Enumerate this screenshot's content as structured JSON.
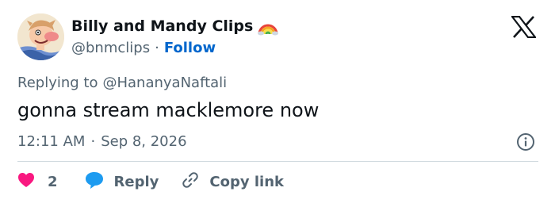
{
  "author": {
    "name": "Billy and Mandy Clips",
    "handle": "@bnmclips",
    "separator": "·",
    "follow_label": "Follow",
    "badge_icon": "rainbow-emoji"
  },
  "brand": {
    "logo_icon": "x-logo-icon"
  },
  "reply_context": {
    "prefix": "Replying to",
    "target": "@HananyaNaftali"
  },
  "tweet": {
    "text": "gonna stream macklemore now",
    "time": "12:11 AM",
    "separator": "·",
    "date": "Sep 8, 2026"
  },
  "actions": {
    "like_count": "2",
    "reply_label": "Reply",
    "copy_label": "Copy link"
  },
  "colors": {
    "text_primary": "#0f1419",
    "text_secondary": "#536471",
    "link": "#0066cc",
    "like": "#f91880",
    "reply": "#1d9bf0",
    "divider": "#cfd9de"
  }
}
